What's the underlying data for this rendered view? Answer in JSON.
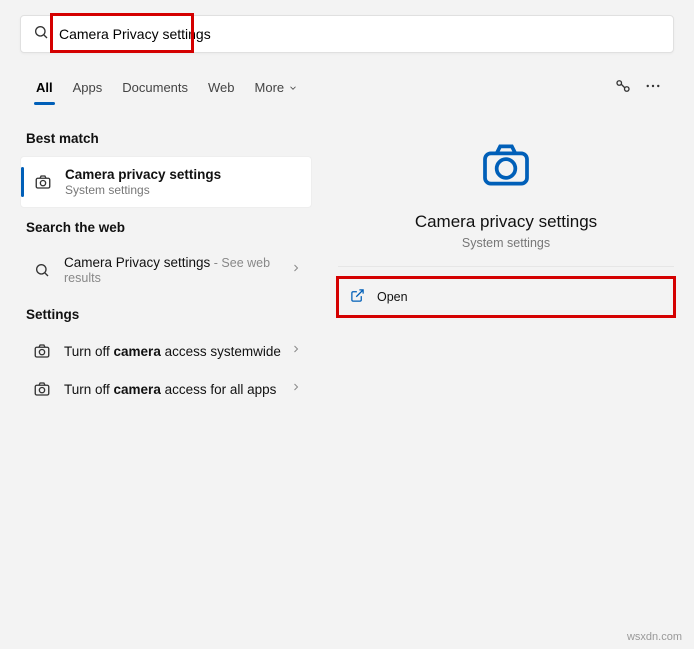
{
  "search": {
    "value": "Camera Privacy settings"
  },
  "tabs": {
    "all": "All",
    "apps": "Apps",
    "documents": "Documents",
    "web": "Web",
    "more": "More"
  },
  "sections": {
    "bestMatch": "Best match",
    "searchWeb": "Search the web",
    "settings": "Settings"
  },
  "bestMatch": {
    "title": "Camera privacy settings",
    "sub": "System settings"
  },
  "webResult": {
    "title": "Camera Privacy settings",
    "suffix": " - See web results"
  },
  "settingsItems": {
    "a_pre": "Turn off ",
    "a_bold": "camera",
    "a_post": " access systemwide",
    "b_pre": "Turn off ",
    "b_bold": "camera",
    "b_post": " access for all apps"
  },
  "detail": {
    "title": "Camera privacy settings",
    "sub": "System settings"
  },
  "actions": {
    "open": "Open"
  },
  "watermark": "wsxdn.com"
}
